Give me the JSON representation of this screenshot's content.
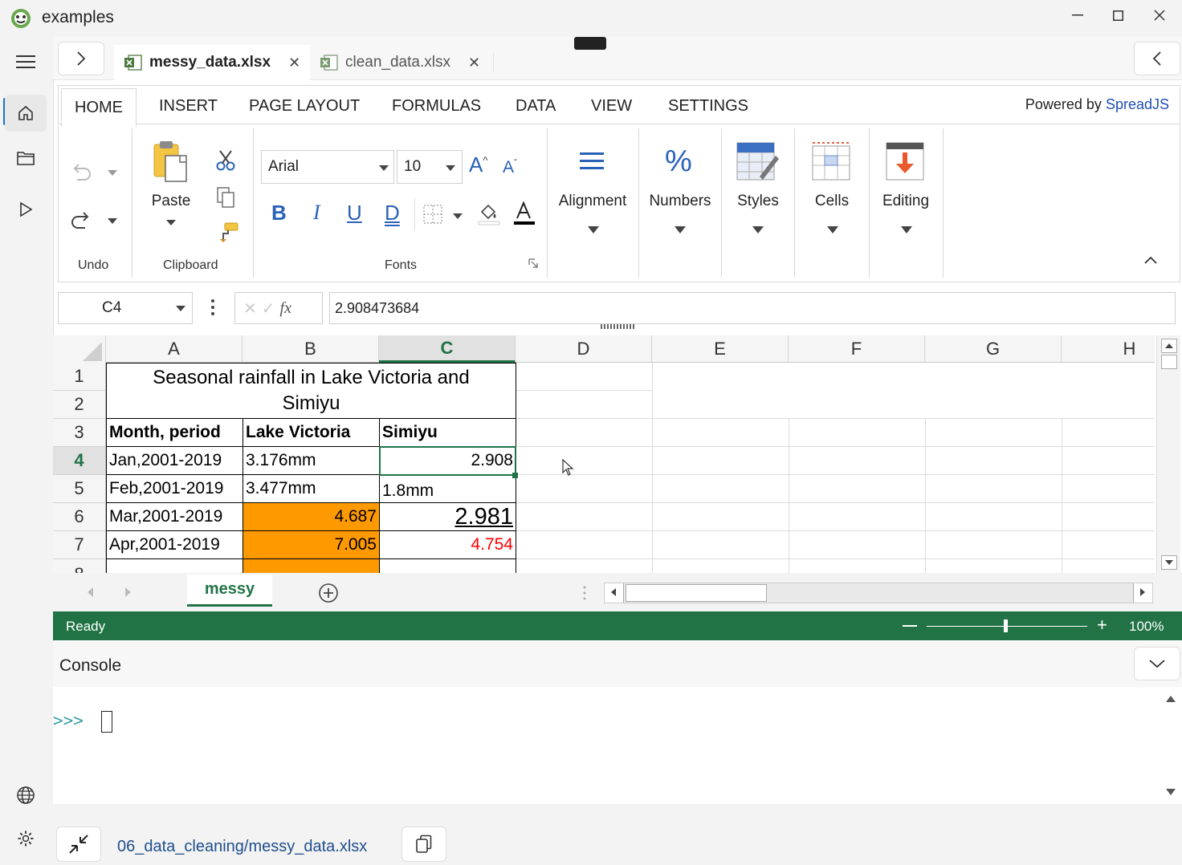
{
  "window": {
    "title": "examples"
  },
  "file_tabs": [
    {
      "label": "messy_data.xlsx",
      "active": true
    },
    {
      "label": "clean_data.xlsx",
      "active": false
    }
  ],
  "ribbon": {
    "tabs": [
      "HOME",
      "INSERT",
      "PAGE LAYOUT",
      "FORMULAS",
      "DATA",
      "VIEW",
      "SETTINGS"
    ],
    "powered_prefix": "Powered by ",
    "powered_brand": "SpreadJS",
    "groups": {
      "undo": "Undo",
      "clipboard": "Clipboard",
      "paste": "Paste",
      "fonts": "Fonts",
      "alignment": "Alignment",
      "numbers": "Numbers",
      "styles": "Styles",
      "cells": "Cells",
      "editing": "Editing"
    },
    "font_name": "Arial",
    "font_size": "10",
    "format_buttons": {
      "bold": "B",
      "italic": "I",
      "underline": "U",
      "double_underline": "D"
    }
  },
  "formula_bar": {
    "name_box": "C4",
    "fx": "fx",
    "formula": "2.908473684"
  },
  "grid": {
    "columns": [
      "A",
      "B",
      "C",
      "D",
      "E",
      "F",
      "G",
      "H"
    ],
    "rows": [
      "1",
      "2",
      "3",
      "4",
      "5",
      "6",
      "7",
      "8"
    ],
    "title_line1": "Seasonal rainfall in Lake Victoria and",
    "title_line2": "Simiyu",
    "headers": [
      "Month, period",
      "Lake Victoria",
      "Simiyu"
    ],
    "data": [
      [
        "Jan,2001-2019",
        "3.176mm",
        "2.908"
      ],
      [
        "Feb,2001-2019",
        "3.477mm",
        "1.8mm"
      ],
      [
        "Mar,2001-2019",
        "4.687",
        "2.981"
      ],
      [
        "Apr,2001-2019",
        "7.005",
        "4.754"
      ]
    ],
    "highlight_color": "#ff9900",
    "red_text_color": "#ff0000"
  },
  "sheet_tabs": {
    "active": "messy"
  },
  "status_bar": {
    "status": "Ready",
    "zoom": "100%"
  },
  "console": {
    "title": "Console",
    "prompt": ">>>"
  },
  "footer": {
    "path": "06_data_cleaning/messy_data.xlsx"
  }
}
